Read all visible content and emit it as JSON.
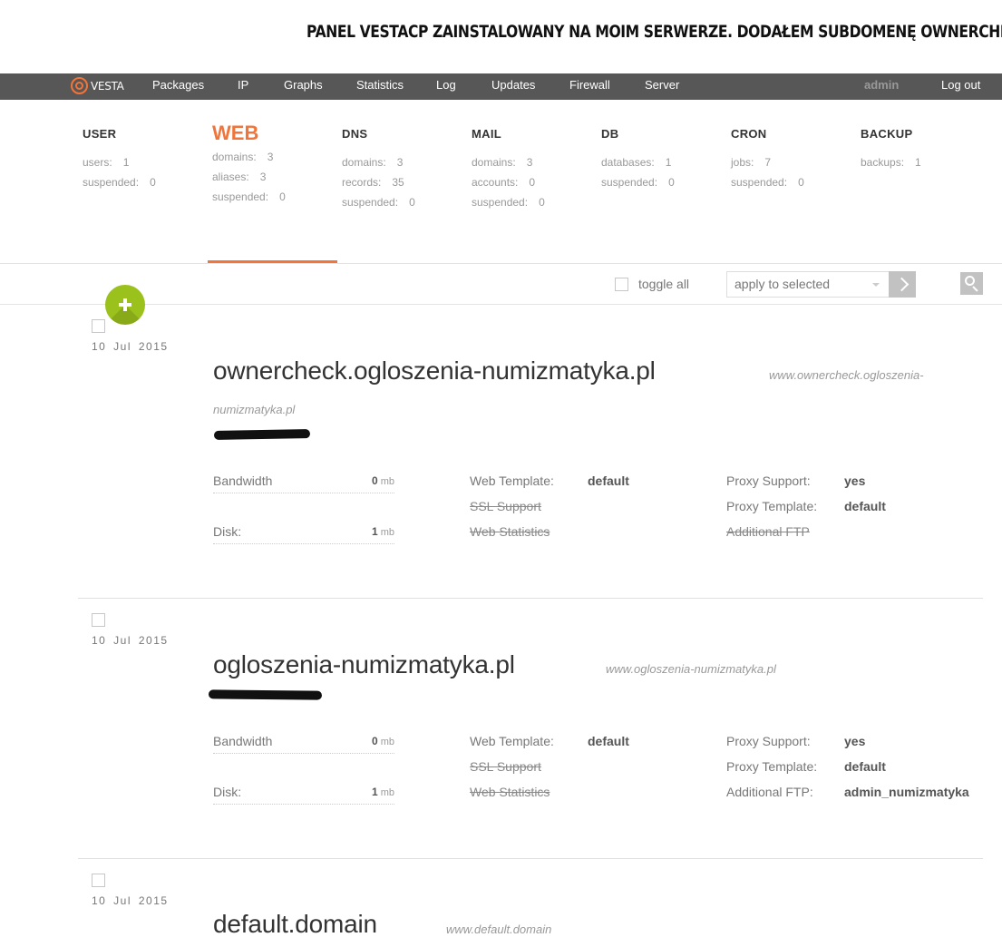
{
  "caption": "PANEL VESTACP ZAINSTALOWANY NA MOIM SERWERZE. DODAŁEM SUBDOMENĘ OWNERCHECK",
  "nav": {
    "logo": "VESTA",
    "items": [
      "Packages",
      "IP",
      "Graphs",
      "Statistics",
      "Log",
      "Updates",
      "Firewall",
      "Server"
    ],
    "user": "admin",
    "logout": "Log out"
  },
  "stats": [
    {
      "title": "USER",
      "rows": [
        {
          "label": "users:",
          "value": "1"
        },
        {
          "label": "suspended:",
          "value": "0"
        }
      ]
    },
    {
      "title": "WEB",
      "active": true,
      "rows": [
        {
          "label": "domains:",
          "value": "3"
        },
        {
          "label": "aliases:",
          "value": "3"
        },
        {
          "label": "suspended:",
          "value": "0"
        }
      ]
    },
    {
      "title": "DNS",
      "rows": [
        {
          "label": "domains:",
          "value": "3"
        },
        {
          "label": "records:",
          "value": "35"
        },
        {
          "label": "suspended:",
          "value": "0"
        }
      ]
    },
    {
      "title": "MAIL",
      "rows": [
        {
          "label": "domains:",
          "value": "3"
        },
        {
          "label": "accounts:",
          "value": "0"
        },
        {
          "label": "suspended:",
          "value": "0"
        }
      ]
    },
    {
      "title": "DB",
      "rows": [
        {
          "label": "databases:",
          "value": "1"
        },
        {
          "label": "suspended:",
          "value": "0"
        }
      ]
    },
    {
      "title": "CRON",
      "rows": [
        {
          "label": "jobs:",
          "value": "7"
        },
        {
          "label": "suspended:",
          "value": "0"
        }
      ]
    },
    {
      "title": "BACKUP",
      "rows": [
        {
          "label": "backups:",
          "value": "1"
        }
      ]
    }
  ],
  "toolbar": {
    "toggle_all": "toggle all",
    "apply_placeholder": "apply to selected"
  },
  "domains": [
    {
      "date": "10 Jul 2015",
      "name": "ownercheck.ogloszenia-numizmatyka.pl",
      "alias_line1": "www.ownercheck.ogloszenia-",
      "alias_line2": "numizmatyka.pl",
      "bandwidth_label": "Bandwidth",
      "bandwidth_value": "0",
      "bandwidth_unit": "mb",
      "disk_label": "Disk:",
      "disk_value": "1",
      "disk_unit": "mb",
      "web_template_label": "Web Template:",
      "web_template": "default",
      "ssl_label": "SSL Support",
      "webstats_label": "Web Statistics",
      "proxy_support_label": "Proxy Support:",
      "proxy_support": "yes",
      "proxy_template_label": "Proxy Template:",
      "proxy_template": "default",
      "ftp_label": "Additional FTP",
      "ftp_value": ""
    },
    {
      "date": "10 Jul 2015",
      "name": "ogloszenia-numizmatyka.pl",
      "alias_line1": "www.ogloszenia-numizmatyka.pl",
      "bandwidth_label": "Bandwidth",
      "bandwidth_value": "0",
      "bandwidth_unit": "mb",
      "disk_label": "Disk:",
      "disk_value": "1",
      "disk_unit": "mb",
      "web_template_label": "Web Template:",
      "web_template": "default",
      "ssl_label": "SSL Support",
      "webstats_label": "Web Statistics",
      "proxy_support_label": "Proxy Support:",
      "proxy_support": "yes",
      "proxy_template_label": "Proxy Template:",
      "proxy_template": "default",
      "ftp_label": "Additional FTP:",
      "ftp_value": "admin_numizmatyka"
    },
    {
      "date": "10 Jul 2015",
      "name": "default.domain",
      "alias_line1": "www.default.domain"
    }
  ],
  "colors": {
    "accent": "#f1753a",
    "add_button": "#9bc11c",
    "nav_bg": "#575757"
  }
}
